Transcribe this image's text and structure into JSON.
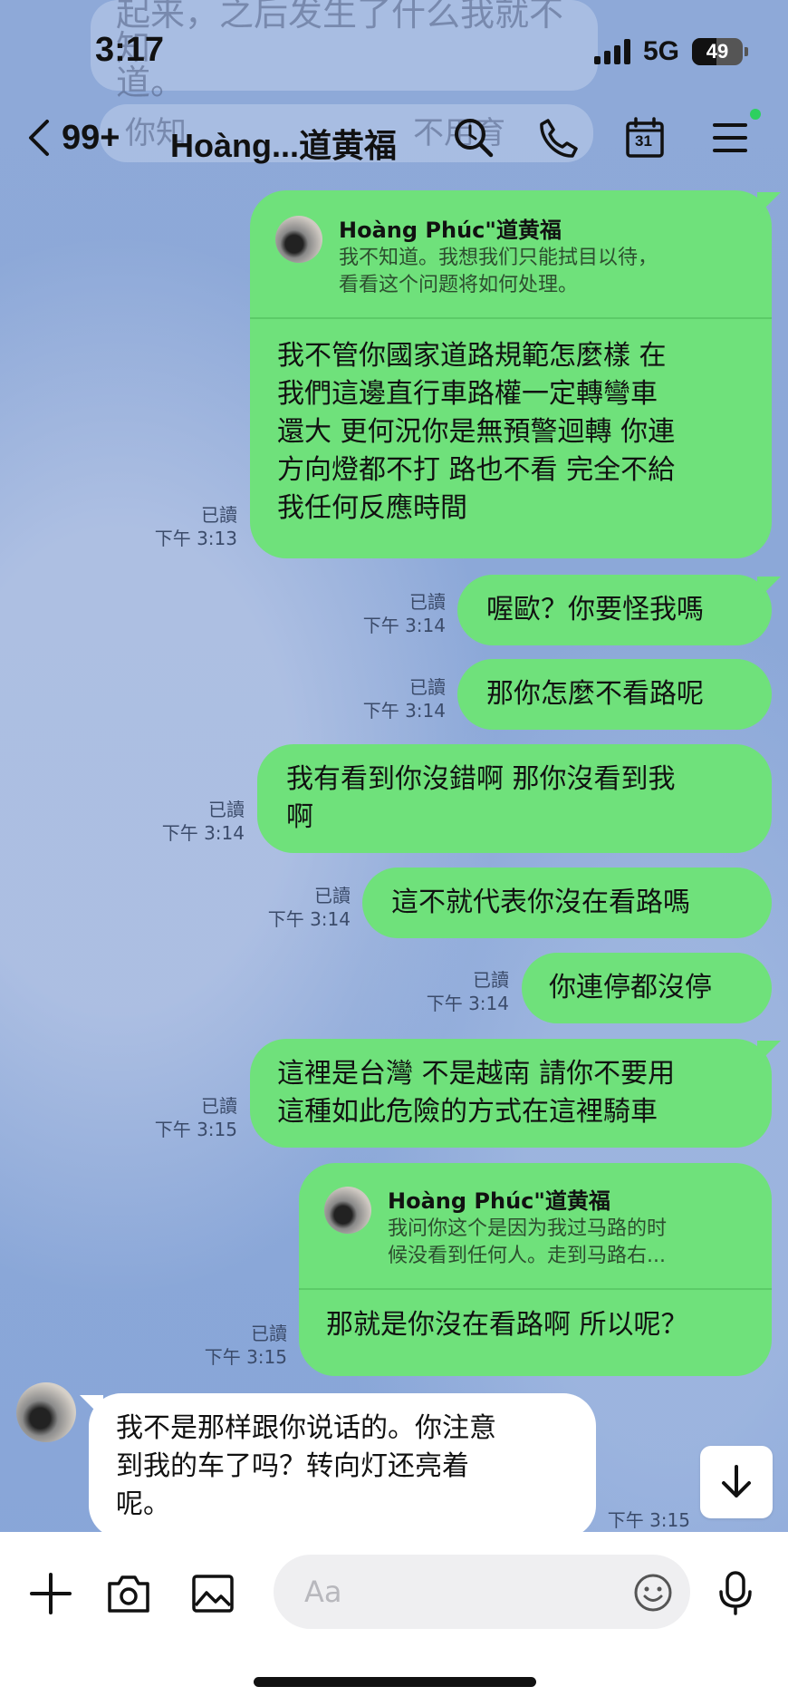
{
  "status_bar": {
    "time": "3:17",
    "network": "5G",
    "battery": "49",
    "battery_level": 0.49
  },
  "header": {
    "back_count": "99+",
    "title": "Hoàng...道黄福",
    "calendar_day": "31"
  },
  "background_ghost": {
    "line1": "起来，之后发生了什么我就不知",
    "line2": "道。",
    "line3": "你知",
    "line3b": "不用",
    "line3c": "育"
  },
  "messages": [
    {
      "read": "已讀",
      "time": "下午 3:13",
      "reply": {
        "name": "Hoàng Phúc\"道黄福",
        "text_lines": [
          "我不知道。我想我们只能拭目以待，",
          "看看这个问题将如何处理。"
        ]
      },
      "lines": [
        "我不管你國家道路規範怎麼樣 在",
        "我們這邊直行車路權一定轉彎車",
        "還大 更何況你是無預警迴轉 你連",
        "方向燈都不打 路也不看 完全不給",
        "我任何反應時間"
      ]
    },
    {
      "read": "已讀",
      "time": "下午 3:14",
      "lines": [
        "喔歐？你要怪我嗎"
      ]
    },
    {
      "read": "已讀",
      "time": "下午 3:14",
      "lines": [
        "那你怎麼不看路呢"
      ]
    },
    {
      "read": "已讀",
      "time": "下午 3:14",
      "lines": [
        "我有看到你沒錯啊 那你沒看到我",
        "啊"
      ]
    },
    {
      "read": "已讀",
      "time": "下午 3:14",
      "lines": [
        "這不就代表你沒在看路嗎"
      ]
    },
    {
      "read": "已讀",
      "time": "下午 3:14",
      "lines": [
        "你連停都沒停"
      ]
    },
    {
      "read": "已讀",
      "time": "下午 3:15",
      "lines": [
        "這裡是台灣 不是越南 請你不要用",
        "這種如此危險的方式在這裡騎車"
      ]
    },
    {
      "read": "已讀",
      "time": "下午 3:15",
      "reply": {
        "name": "Hoàng Phúc\"道黄福",
        "text_lines": [
          "我问你这个是因为我过马路的时",
          "候没看到任何人。走到马路右..."
        ]
      },
      "lines": [
        "那就是你沒在看路啊 所以呢？"
      ]
    }
  ],
  "incoming": {
    "lines": [
      "我不是那样跟你说话的。你注意",
      "到我的车了吗？转向灯还亮着",
      "呢。"
    ],
    "time": "下午 3:15"
  },
  "composer": {
    "placeholder": "Aa"
  },
  "icons": [
    "back-icon",
    "search-icon",
    "phone-icon",
    "calendar-icon",
    "menu-icon",
    "scroll-down-icon",
    "plus-icon",
    "camera-icon",
    "image-icon",
    "emoji-icon",
    "mic-icon"
  ],
  "colors": {
    "background": "#8fabd9",
    "outgoing_bubble": "#6fe17b",
    "incoming_bubble": "#ffffff",
    "badge": "#2dd05f"
  }
}
